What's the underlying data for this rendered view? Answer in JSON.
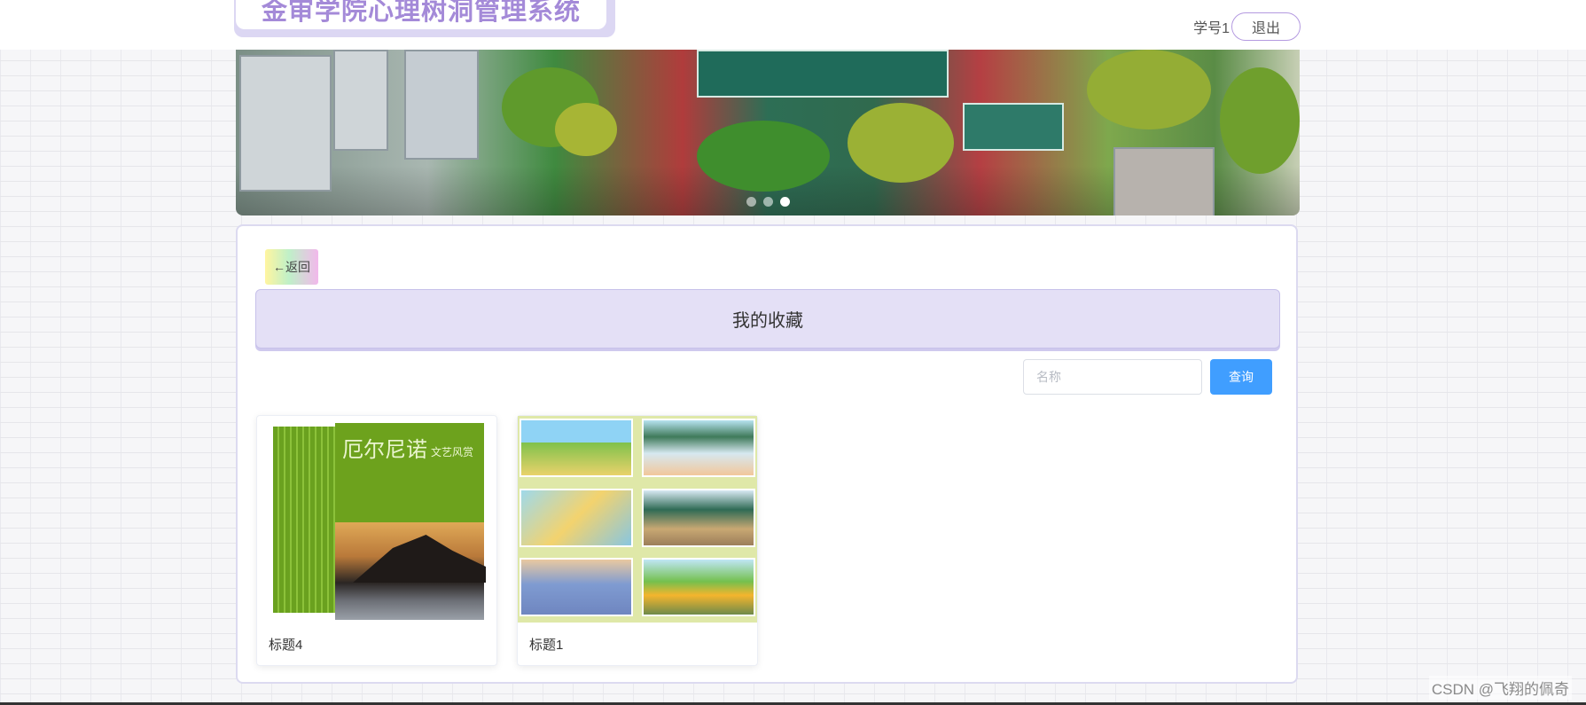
{
  "header": {
    "app_title": "金审学院心理树洞管理系统",
    "user_name": "学号1",
    "logout_label": "退出"
  },
  "banner": {
    "slide_count": 3,
    "active_slide": 3
  },
  "content": {
    "back_label": "←返回",
    "page_title": "我的收藏",
    "search": {
      "placeholder": "名称",
      "value": "",
      "button_label": "查询"
    },
    "cards": [
      {
        "title": "标题4",
        "cover_title": "厄尔尼诺",
        "cover_subtitle": "文艺风赏"
      },
      {
        "title": "标题1"
      }
    ]
  },
  "watermark": "CSDN @飞翔的佩奇",
  "colors": {
    "accent": "#a48ad8",
    "primary_button": "#409eff",
    "title_bar_bg": "#e4e0f6"
  }
}
